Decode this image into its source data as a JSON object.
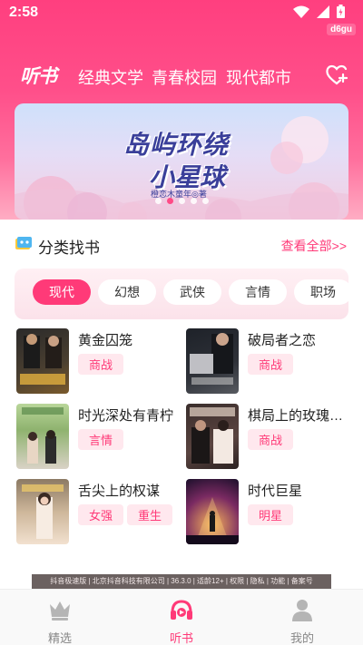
{
  "status_bar": {
    "time": "2:58",
    "device_label": "d6gu"
  },
  "top_nav": {
    "logo": "听书",
    "tabs": [
      {
        "label": "经典文学"
      },
      {
        "label": "青春校园"
      },
      {
        "label": "现代都市"
      }
    ],
    "favorite_icon": "heart-plus-icon"
  },
  "banner": {
    "line1": "岛屿环绕",
    "line2": "小星球",
    "credit": "橙恋木童年◎著",
    "page_count": 5,
    "active_page": 1
  },
  "category_section": {
    "title": "分类找书",
    "more_label": "查看全部>>",
    "chips": [
      {
        "label": "现代",
        "active": true
      },
      {
        "label": "幻想",
        "active": false
      },
      {
        "label": "武侠",
        "active": false
      },
      {
        "label": "言情",
        "active": false
      },
      {
        "label": "职场",
        "active": false
      }
    ]
  },
  "books": [
    {
      "title": "黄金囚笼",
      "tags": [
        "商战"
      ]
    },
    {
      "title": "破局者之恋",
      "tags": [
        "商战"
      ]
    },
    {
      "title": "时光深处有青柠",
      "tags": [
        "言情"
      ]
    },
    {
      "title": "棋局上的玫瑰…",
      "tags": [
        "商战"
      ]
    },
    {
      "title": "舌尖上的权谋",
      "tags": [
        "女强",
        "重生"
      ]
    },
    {
      "title": "时代巨星",
      "tags": [
        "明星"
      ]
    }
  ],
  "footer_info": "抖音极速版 | 北京抖音科技有限公司 | 36.3.0 | 适龄12+ | 权限 | 隐私 | 功能 | 备案号",
  "bottom_nav": [
    {
      "label": "精选",
      "icon": "crown-icon",
      "active": false
    },
    {
      "label": "听书",
      "icon": "headphones-icon",
      "active": true
    },
    {
      "label": "我的",
      "icon": "person-icon",
      "active": false
    }
  ],
  "colors": {
    "brand": "#ff3a78",
    "header": "#ff4f8a"
  }
}
